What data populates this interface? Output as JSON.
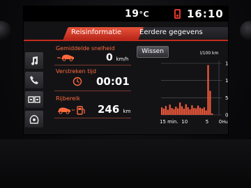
{
  "status": {
    "temperature": "19",
    "temperature_unit": "°C",
    "time": "16:10",
    "phone_icon": "phone-icon"
  },
  "tabs": [
    {
      "label": "Reisinformatie",
      "active": true
    },
    {
      "label": "Eerdere gegevens",
      "active": false
    }
  ],
  "sidebar": {
    "items": [
      {
        "icon": "music-note-icon"
      },
      {
        "icon": "phone-handset-icon"
      },
      {
        "icon": "vehicle-settings-icon"
      },
      {
        "icon": "trip-info-icon"
      }
    ]
  },
  "info": {
    "avg_speed": {
      "label": "Gemiddelde snelheid",
      "value": "0",
      "unit": "km/h"
    },
    "elapsed_time": {
      "label": "Verstreken tijd",
      "value": "00:01"
    },
    "range": {
      "label": "Rijbereik",
      "value": "246",
      "unit": "km"
    }
  },
  "reset_button": {
    "label": "Wissen"
  },
  "chart_data": {
    "type": "bar",
    "unit_label": "l/100 km",
    "y_ticks": [
      "15",
      "10",
      "5",
      "0"
    ],
    "ylim": [
      0,
      15
    ],
    "x_ticks": [
      "15 min.",
      "10",
      "5",
      "0"
    ],
    "now_label": "Huidig",
    "values": [
      2.2,
      1.8,
      2.6,
      1.5,
      3.0,
      2.0,
      1.7,
      2.4,
      1.9,
      3.6,
      2.5,
      1.8,
      3.1,
      2.2,
      1.6,
      2.8,
      2.0,
      1.9,
      2.7,
      2.1,
      1.8,
      2.2,
      1.3,
      14.5,
      7.0,
      0.4
    ],
    "colors": {
      "bar": "#f0593a",
      "grid": "#5a5a60"
    }
  }
}
